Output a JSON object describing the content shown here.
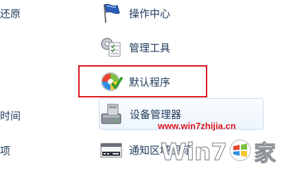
{
  "left_fragments": [
    "还原",
    "时间",
    "项"
  ],
  "items": [
    {
      "label": "操作中心",
      "icon": "action-center-flag-icon"
    },
    {
      "label": "管理工具",
      "icon": "admin-tools-icon"
    },
    {
      "label": "默认程序",
      "icon": "default-programs-icon"
    },
    {
      "label": "设备管理器",
      "icon": "device-manager-icon"
    },
    {
      "label": "通知区域图标",
      "icon": "notification-area-icons-icon"
    }
  ],
  "colors": {
    "link_text": "#1e395b",
    "highlight_border": "#d9141b",
    "watermark": "#e1141b"
  },
  "watermark": {
    "url": "www.win7zhijia.cn",
    "logo_text": "Win7之家"
  }
}
